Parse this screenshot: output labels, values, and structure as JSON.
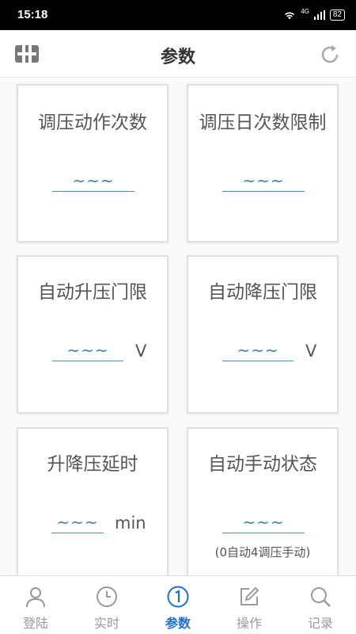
{
  "status_bar": {
    "time": "15:18",
    "network": "4G",
    "battery": "82"
  },
  "header": {
    "title": "参数",
    "left_icon": "toggle-icon",
    "right_icon": "refresh-icon"
  },
  "cards": [
    {
      "title": "调压动作次数",
      "value": "~~~",
      "unit": "",
      "note": ""
    },
    {
      "title": "调压日次数限制",
      "value": "~~~",
      "unit": "",
      "note": ""
    },
    {
      "title": "自动升压门限",
      "value": "~~~",
      "unit": "V",
      "note": ""
    },
    {
      "title": "自动降压门限",
      "value": "~~~",
      "unit": "V",
      "note": ""
    },
    {
      "title": "升降压延时",
      "value": "~~~",
      "unit": "min",
      "note": ""
    },
    {
      "title": "自动手动状态",
      "value": "~~~",
      "unit": "",
      "note": "(0自动4调压手动)"
    }
  ],
  "nav": [
    {
      "label": "登陆",
      "icon": "person-icon"
    },
    {
      "label": "实时",
      "icon": "clock-icon"
    },
    {
      "label": "参数",
      "icon": "number-one-icon",
      "active": true
    },
    {
      "label": "操作",
      "icon": "edit-icon"
    },
    {
      "label": "记录",
      "icon": "search-icon"
    }
  ],
  "colors": {
    "accent": "#1a6fd4",
    "underline": "#4a90b8",
    "inactive": "#9a9a9a"
  }
}
